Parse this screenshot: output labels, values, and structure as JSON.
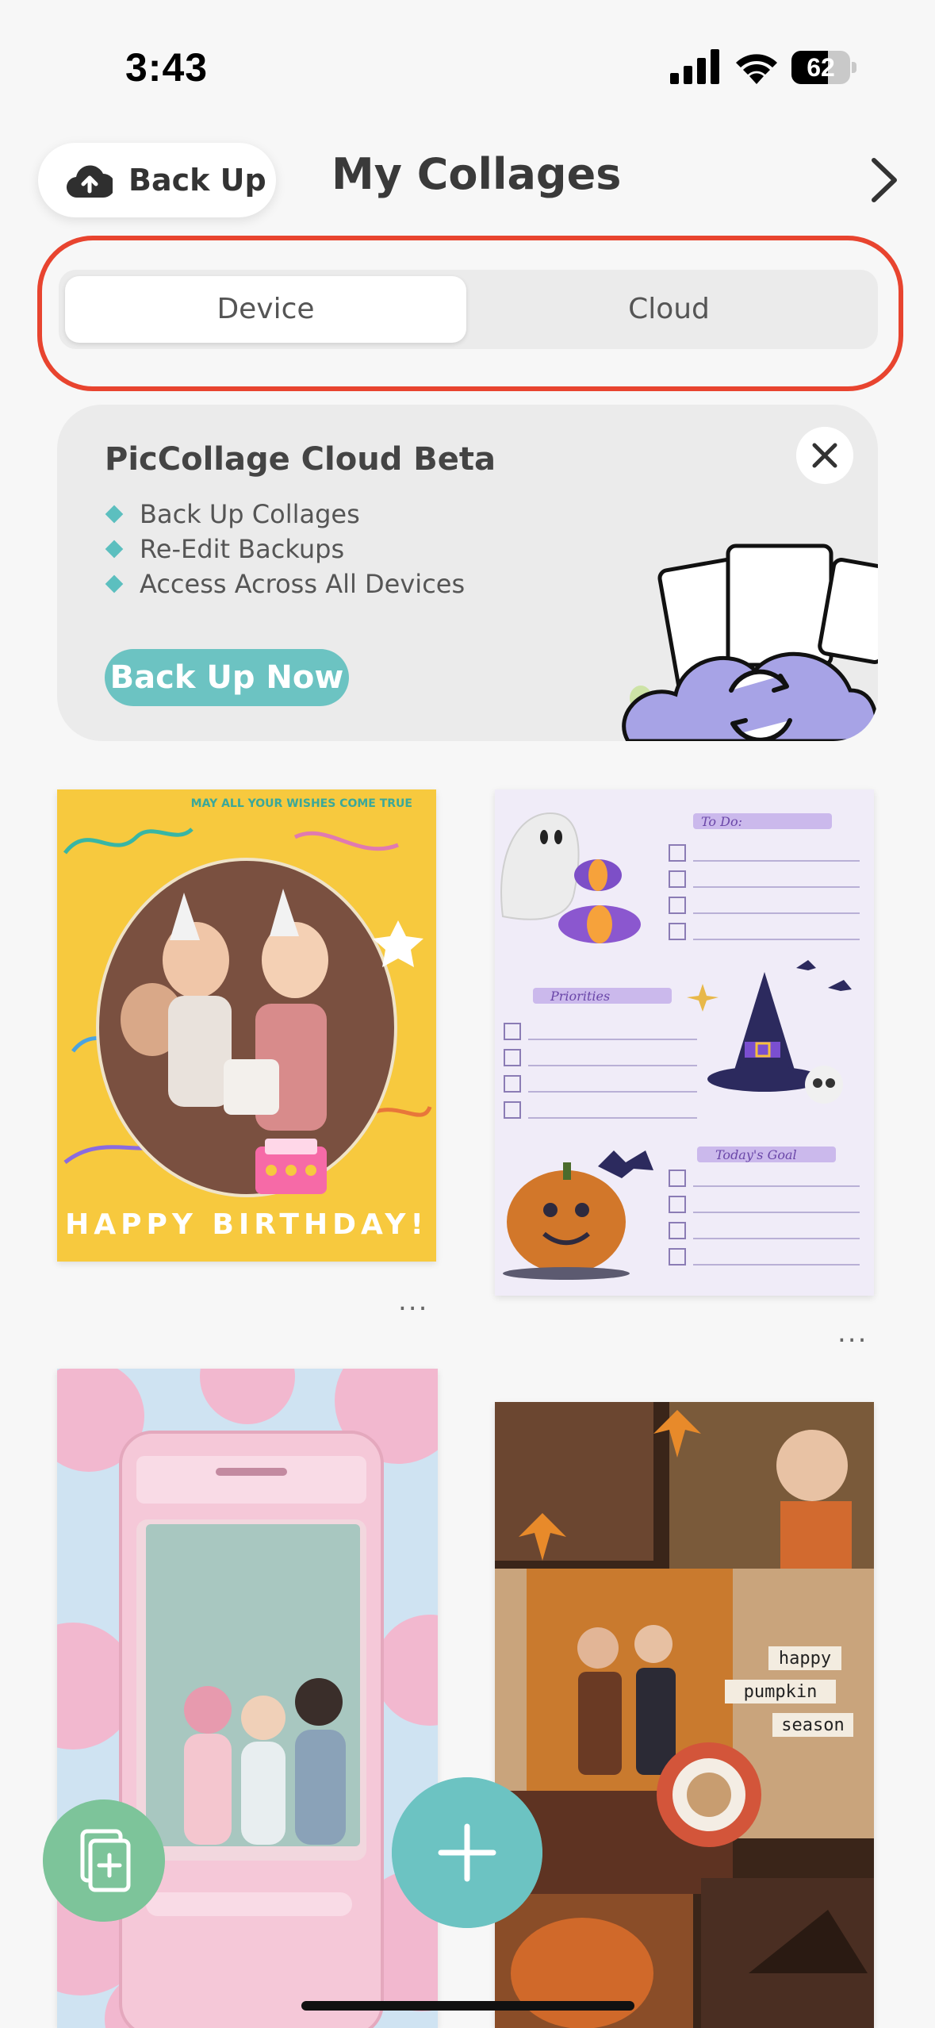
{
  "status_bar": {
    "time": "3:43",
    "battery_percent": "62",
    "battery_level": 0.62
  },
  "header": {
    "backup_label": "Back Up",
    "title": "My Collages"
  },
  "segmented": {
    "options": [
      "Device",
      "Cloud"
    ],
    "selected": "Device"
  },
  "cloud_card": {
    "title": "PicCollage Cloud Beta",
    "features": [
      "Back Up Collages",
      "Re-Edit Backups",
      "Access Across All Devices"
    ],
    "button_label": "Back Up Now"
  },
  "collages": {
    "birthday": {
      "top_text": "MAY ALL YOUR WISHES COME TRUE",
      "arc_text": "MAY ALL YOUR WISHES COME TRUE",
      "bottom_text": "HAPPY BIRTHDAY!"
    },
    "halloween": {
      "todo": "To Do:",
      "priorities": "Priorities",
      "goal": "Today's Goal"
    },
    "pumpkin": {
      "line1": "happy",
      "line2": "pumpkin",
      "line3": "season"
    }
  },
  "more_label": "...",
  "colors": {
    "accent_teal": "#6cc3c2",
    "highlight_red": "#e8442f",
    "fab_green": "#7dc49a"
  }
}
